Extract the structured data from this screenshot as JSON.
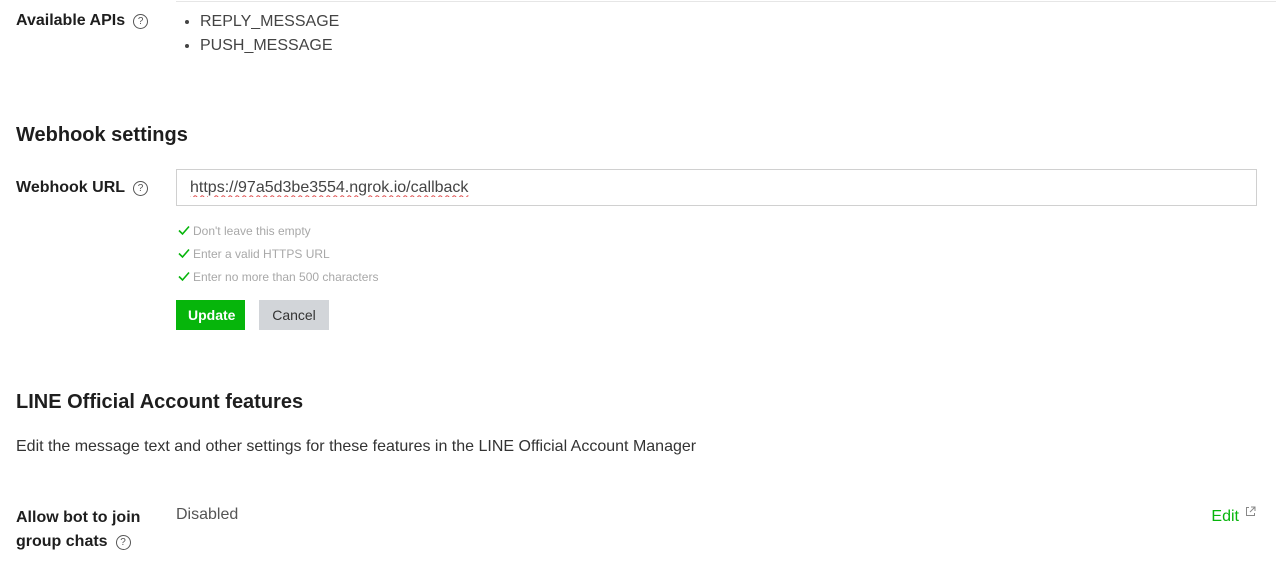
{
  "available_apis": {
    "label": "Available APIs",
    "help_symbol": "?",
    "items": [
      "REPLY_MESSAGE",
      "PUSH_MESSAGE"
    ]
  },
  "webhook": {
    "section_title": "Webhook settings",
    "url_label": "Webhook URL",
    "help_symbol": "?",
    "url_value": "https://97a5d3be3554.ngrok.io/callback",
    "rules": [
      "Don't leave this empty",
      "Enter a valid HTTPS URL",
      "Enter no more than 500 characters"
    ],
    "update_label": "Update",
    "cancel_label": "Cancel"
  },
  "oa_features": {
    "section_title": "LINE Official Account features",
    "description": "Edit the message text and other settings for these features in the LINE Official Account Manager",
    "join_group": {
      "label_line1": "Allow bot to join",
      "label_line2": "group chats",
      "help_symbol": "?",
      "value": "Disabled",
      "edit_label": "Edit"
    }
  },
  "colors": {
    "accent_green": "#06b50b",
    "cancel_gray": "#d2d5d9",
    "rule_text": "#a8a8a8"
  },
  "icons": [
    "help-icon",
    "check-icon",
    "external-link-icon"
  ]
}
